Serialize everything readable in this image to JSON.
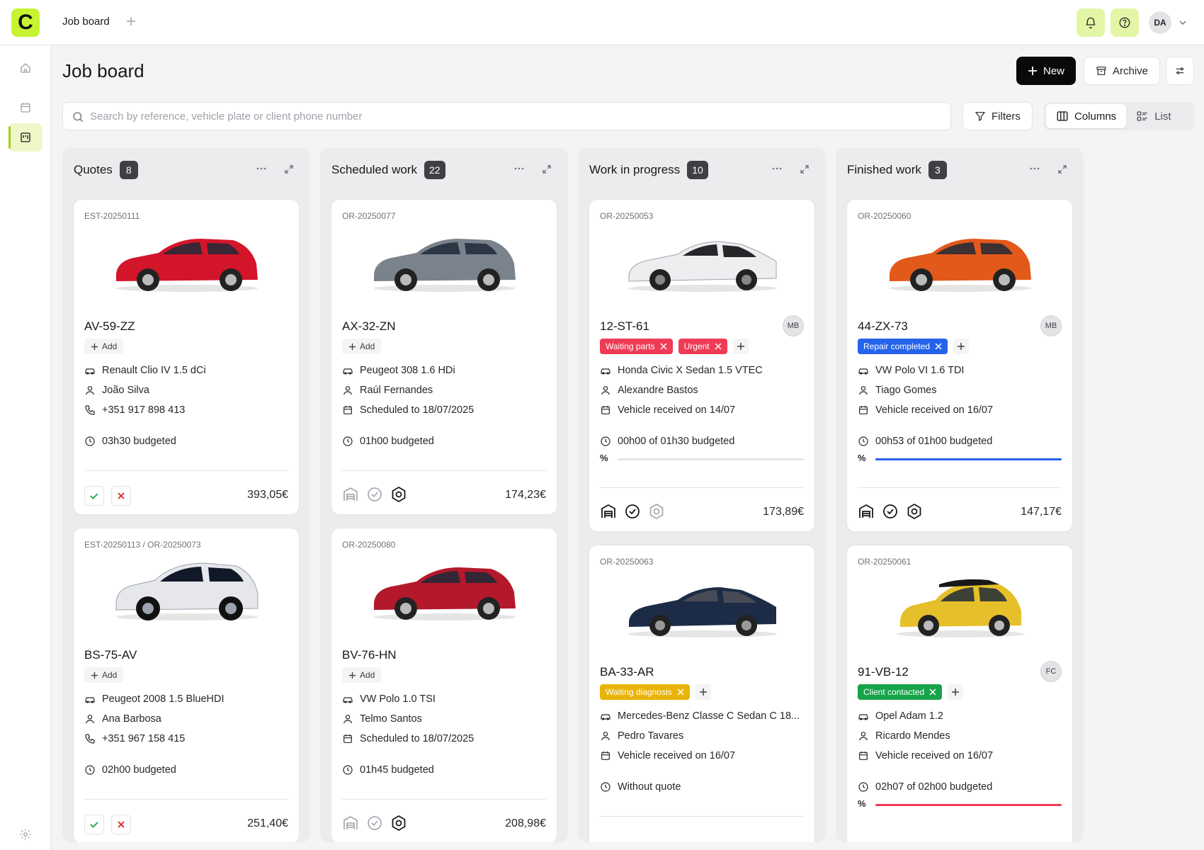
{
  "app": {
    "logo_letter": "C",
    "active_tab": "Job board",
    "avatar_initials": "DA"
  },
  "page": {
    "title": "Job board"
  },
  "toolbar": {
    "new_label": "New",
    "archive_label": "Archive",
    "filters_label": "Filters",
    "columns_label": "Columns",
    "list_label": "List"
  },
  "search": {
    "placeholder": "Search by reference, vehicle plate or client phone number",
    "value": ""
  },
  "colors": {
    "accent": "#c6f432",
    "tag_red": "#ef3b55",
    "tag_blue": "#2563eb",
    "tag_yellow": "#eab308",
    "tag_green": "#16a34a"
  },
  "columns": [
    {
      "title": "Quotes",
      "count": "8"
    },
    {
      "title": "Scheduled work",
      "count": "22"
    },
    {
      "title": "Work in progress",
      "count": "10"
    },
    {
      "title": "Finished work",
      "count": "3"
    }
  ],
  "cards": {
    "q1": {
      "ref": "EST-20250111",
      "plate": "AV-59-ZZ",
      "add_label": "Add",
      "vehicle": "Renault Clio IV 1.5 dCi",
      "client": "João Silva",
      "phone": "+351 917 898 413",
      "budget": "03h30 budgeted",
      "price": "393,05€",
      "car_color": "#d3152a"
    },
    "q2": {
      "ref": "EST-20250113 / OR-20250073",
      "plate": "BS-75-AV",
      "add_label": "Add",
      "vehicle": "Peugeot 2008 1.5 BlueHDI",
      "client": "Ana Barbosa",
      "phone": "+351 967 158 415",
      "budget": "02h00 budgeted",
      "price": "251,40€",
      "car_color": "#e5e7ea"
    },
    "s1": {
      "ref": "OR-20250077",
      "plate": "AX-32-ZN",
      "add_label": "Add",
      "vehicle": "Peugeot 308 1.6 HDi",
      "client": "Raúl Fernandes",
      "date": "Scheduled to 18/07/2025",
      "budget": "01h00 budgeted",
      "price": "174,23€",
      "car_color": "#7a838c"
    },
    "s2": {
      "ref": "OR-20250080",
      "plate": "BV-76-HN",
      "add_label": "Add",
      "vehicle": "VW Polo 1.0 TSI",
      "client": "Telmo Santos",
      "date": "Scheduled to 18/07/2025",
      "budget": "01h45 budgeted",
      "price": "208,98€",
      "car_color": "#b3192b"
    },
    "w1": {
      "ref": "OR-20250053",
      "plate": "12-ST-61",
      "assignee": "MB",
      "tags": [
        "Waiting parts",
        "Urgent"
      ],
      "vehicle": "Honda Civic X Sedan 1.5 VTEC",
      "client": "Alexandre Bastos",
      "date": "Vehicle received on 14/07",
      "budget": "00h00 of 01h30 budgeted",
      "progress": 0,
      "price": "173,89€",
      "car_color": "#eceef0"
    },
    "w2": {
      "ref": "OR-20250063",
      "plate": "BA-33-AR",
      "tags": [
        "Waiting diagnosis"
      ],
      "vehicle": "Mercedes-Benz Classe C Sedan C 18...",
      "client": "Pedro Tavares",
      "date": "Vehicle received on 16/07",
      "budget": "Without quote",
      "car_color": "#1c2c46"
    },
    "f1": {
      "ref": "OR-20250060",
      "plate": "44-ZX-73",
      "assignee": "MB",
      "tags": [
        "Repair completed"
      ],
      "vehicle": "VW Polo VI 1.6 TDI",
      "client": "Tiago Gomes",
      "date": "Vehicle received on 16/07",
      "budget": "00h53 of 01h00 budgeted",
      "progress": 100,
      "price": "147,17€",
      "car_color": "#e2591a"
    },
    "f2": {
      "ref": "OR-20250061",
      "plate": "91-VB-12",
      "assignee": "FC",
      "tags": [
        "Client contacted"
      ],
      "vehicle": "Opel Adam 1.2",
      "client": "Ricardo Mendes",
      "date": "Vehicle received on 16/07",
      "budget": "02h07 of 02h00 budgeted",
      "progress": 100,
      "car_color": "#e5c02a"
    }
  }
}
